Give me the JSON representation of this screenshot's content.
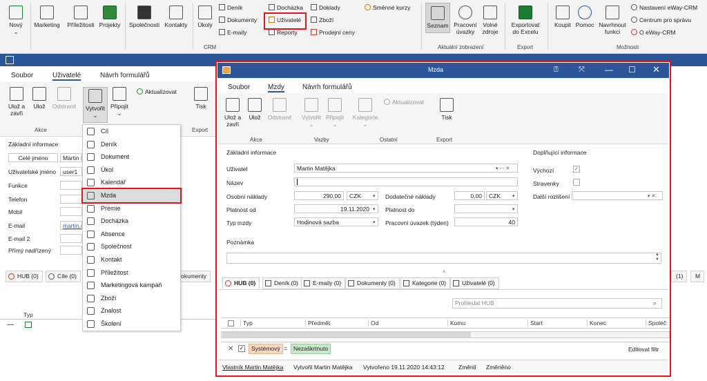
{
  "ribbon": {
    "novy": "Nový",
    "marketing": "Marketing",
    "prilezitosti": "Příležitosti",
    "projekty": "Projekty",
    "spolecnosti": "Společnosti",
    "kontakty": "Kontakty",
    "ukoly": "Úkoly",
    "denik": "Deník",
    "dochazka": "Docházka",
    "doklady": "Doklady",
    "smenne_kurzy": "Směnné kurzy",
    "dokumenty": "Dokumenty",
    "uzivatele": "Uživatelé",
    "zbozi": "Zboží",
    "emaily": "E-maily",
    "reporty": "Reporty",
    "prodejni_ceny": "Prodejní ceny",
    "seznam": "Seznam",
    "pracovni_uvazky_1": "Pracovní",
    "pracovni_uvazky_2": "úvazky",
    "volne_zdroje_1": "Volné",
    "volne_zdroje_2": "zdroje",
    "exportovat_1": "Exportovat",
    "exportovat_2": "do Excelu",
    "koupit": "Koupit",
    "pomoc": "Pomoc",
    "navrhnout_1": "Navrhnout",
    "navrhnout_2": "funkci",
    "nastaveni": "Nastavení eWay-CRM",
    "centrum": "Centrum pro správu",
    "o_eway": "O eWay-CRM",
    "grp_crm": "CRM",
    "grp_aktualni": "Aktuální zobrazení",
    "grp_export": "Export",
    "grp_moznosti": "Možnosti"
  },
  "bg": {
    "tab_soubor": "Soubor",
    "tab_uzivatele": "Uživatelé",
    "tab_navrh": "Návrh formulářů",
    "uloz_zavri_1": "Ulož a",
    "uloz_zavri_2": "zavři",
    "uloz": "Ulož",
    "odstranit": "Odstranit",
    "vytvorit": "Vytvořit",
    "pripojit": "Připojit",
    "aktualizovat": "Aktualizovat",
    "tisk": "Tisk",
    "grp_akce": "Akce",
    "grp_export": "Export",
    "zakladni": "Základní informace",
    "cele_jmeno": "Celé jméno",
    "cele_jmeno_val": "Martin M",
    "uzivatelske_jmeno": "Uživatelské jméno",
    "uzivatelske_jmeno_val": "user1",
    "funkce": "Funkce",
    "telefon": "Telefon",
    "mobil": "Mobil",
    "email": "E-mail",
    "email_val": "martin.m",
    "email2": "E-mail 2",
    "primy": "Přímý nadřízený",
    "hub_tab": "HUB (0)",
    "cile_tab": "Cíle (0)",
    "dokumenty_tab": "Dokumenty",
    "typ": "Typ",
    "right_tab1": "(1)",
    "right_tab2": "M"
  },
  "menu": [
    "Cíl",
    "Deník",
    "Dokument",
    "Úkol",
    "Kalendář",
    "Mzda",
    "Prémie",
    "Docházka",
    "Absence",
    "Společnost",
    "Kontakt",
    "Příležitost",
    "Marketingová kampaň",
    "Zboží",
    "Znalost",
    "Školení"
  ],
  "dlg": {
    "title": "Mzda",
    "tab_soubor": "Soubor",
    "tab_mzdy": "Mzdy",
    "tab_navrh": "Návrh formulářů",
    "uloz_zavri_1": "Ulož a",
    "uloz_zavri_2": "zavři",
    "uloz": "Ulož",
    "odstranit": "Odstranit",
    "vytvorit": "Vytvořit",
    "pripojit": "Připojit",
    "kategorie": "Kategorie",
    "aktualizovat": "Aktualizovat",
    "tisk": "Tisk",
    "grp_akce": "Akce",
    "grp_vazby": "Vazby",
    "grp_ostatni": "Ostatní",
    "grp_export": "Export",
    "zakladni": "Základní informace",
    "doplnujici": "Doplňující informace",
    "uzivatel": "Uživatel",
    "uzivatel_val": "Martin Matějka",
    "nazev": "Název",
    "osobni": "Osobní náklady",
    "osobni_val": "290,00",
    "mena": "CZK",
    "dodatecne": "Dodatečné náklady",
    "dodatecne_val": "0,00",
    "mena2": "CZK",
    "platnost_od": "Platnost od",
    "platnost_od_val": "19.11.2020",
    "platnost_do": "Platnost do",
    "typ_mzdy": "Typ mzdy",
    "typ_mzdy_val": "Hodinová sazba",
    "uvazek": "Pracovní úvazek (týden)",
    "uvazek_val": "40",
    "vychozi": "Výchozí",
    "stravenky": "Stravenky",
    "dalsi": "Další rozlišení",
    "poznamka": "Poznámka",
    "tabs": [
      "HUB (0)",
      "Deník (0)",
      "E-maily (0)",
      "Dokumenty (0)",
      "Kategorie (0)",
      "Uživatelé (0)"
    ],
    "search_ph": "Prohledat HUB",
    "cols": [
      "Typ",
      "Předmět",
      "Od",
      "Komu",
      "Start",
      "Konec",
      "Společ"
    ],
    "filter_sys": "Systémový",
    "filter_eq": "=",
    "filter_val": "Nezaškrtnuto",
    "edit_filter": "Editovat filtr",
    "status": [
      "Vlastník Martin Matějka",
      "Vytvořil Martin Matějka",
      "Vytvořeno 19.11.2020 14:43:12",
      "Změnil",
      "Změněno"
    ]
  },
  "colors": {
    "accent": "#2b579a",
    "highlight": "#e0141e"
  }
}
